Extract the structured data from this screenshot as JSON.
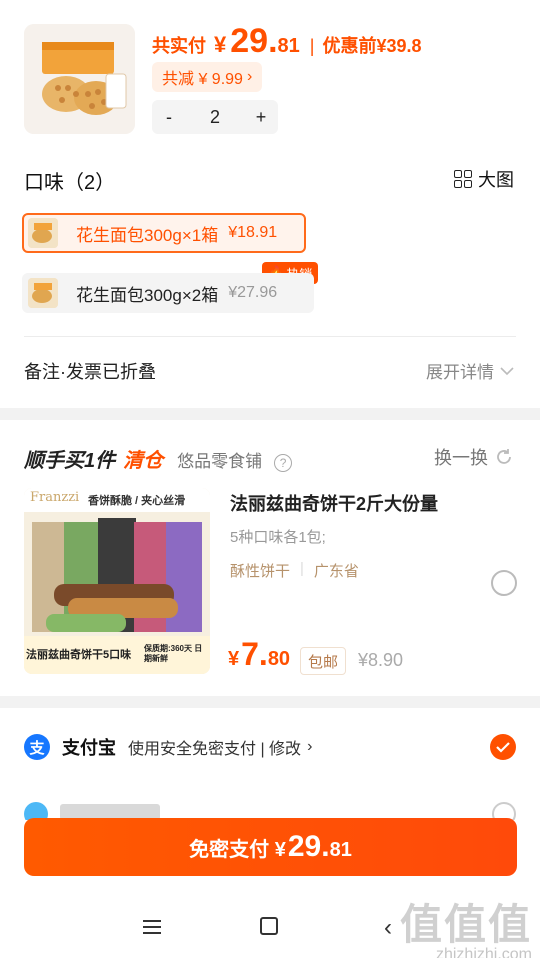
{
  "order": {
    "paid_label": "共实付",
    "paid_yen": "¥",
    "paid_int": "29.",
    "paid_dec": "81",
    "separator": "|",
    "orig_label": "优惠前",
    "orig_price": "¥39.8",
    "discount_text": "共减 ¥ 9.99",
    "discount_chevron": "›",
    "qty_minus": "-",
    "qty_value": "2",
    "qty_plus": "+"
  },
  "flavor": {
    "title": "口味（2）",
    "big_view_label": "大图",
    "options": [
      {
        "name": "花生面包300g×1箱",
        "price": "¥18.91",
        "selected": true
      },
      {
        "name": "花生面包300g×2箱",
        "price": "¥27.96",
        "selected": false,
        "badge": "热销"
      }
    ]
  },
  "note": {
    "left_label": "备注·发票已折叠",
    "right_label": "展开详情"
  },
  "recommend": {
    "title_main": "顺手买1件",
    "title_accent": "清仓",
    "shop": "悠品零食铺",
    "help_glyph": "?",
    "swap_label": "换一换",
    "product": {
      "name": "法丽兹曲奇饼干2斤大份量",
      "desc": "5种口味各1包;",
      "tag1": "酥性饼干",
      "tag_sep": "|",
      "tag2": "广东省",
      "price_yen": "¥",
      "price_int": "7.",
      "price_dec": "80",
      "ship_tag": "包邮",
      "orig_price": "¥8.90",
      "image_brand": "Franzzi",
      "image_slogan": "香饼酥脆 / 夹心丝滑",
      "image_caption": "法丽兹曲奇饼干5口味",
      "image_shelf": "保质期:360天 日期新鲜"
    }
  },
  "payment": {
    "icon_glyph": "支",
    "method_name": "支付宝",
    "method_desc": "使用安全免密支付 | 修改",
    "method_chevron": "›"
  },
  "pay_button": {
    "label": "免密支付 ¥",
    "int": "29.",
    "dec": "81"
  },
  "navbar": {
    "back_glyph": "‹"
  },
  "watermark": {
    "top": "值值值",
    "bottom": "zhizhizhi.com"
  },
  "colors": {
    "accent": "#ff5000",
    "alipay_blue": "#1677ff"
  }
}
